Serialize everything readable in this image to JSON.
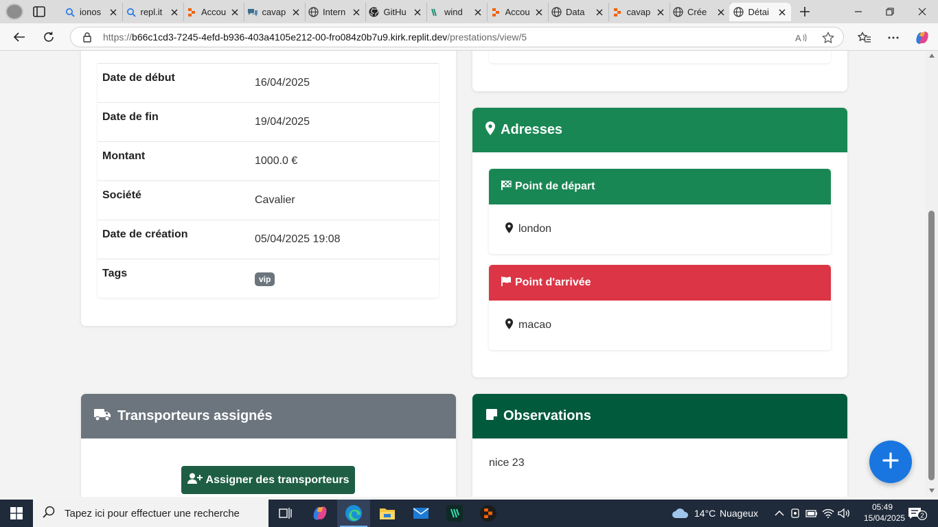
{
  "browser": {
    "tabs": [
      {
        "title": "ionos",
        "favicon": "search-icon"
      },
      {
        "title": "repl.it",
        "favicon": "search-icon"
      },
      {
        "title": "Accou",
        "favicon": "replit-icon"
      },
      {
        "title": "cavap",
        "favicon": "chat-icon"
      },
      {
        "title": "Intern",
        "favicon": "globe-icon"
      },
      {
        "title": "GitHu",
        "favicon": "github-icon"
      },
      {
        "title": "wind",
        "favicon": "windsurf-icon"
      },
      {
        "title": "Accou",
        "favicon": "replit-icon"
      },
      {
        "title": "Data",
        "favicon": "globe-icon"
      },
      {
        "title": "cavap",
        "favicon": "replit-icon"
      },
      {
        "title": "Crée",
        "favicon": "globe-icon"
      },
      {
        "title": "Détai",
        "favicon": "globe-icon",
        "active": true
      }
    ],
    "url_prefix": "https://",
    "url_host": "b66c1cd3-7245-4efd-b936-403a4105e212-00-fro084z0b7u9.kirk.replit.dev",
    "url_path": "/prestations/view/5"
  },
  "details": {
    "rows": [
      {
        "label": "Date de début",
        "value": "16/04/2025"
      },
      {
        "label": "Date de fin",
        "value": "19/04/2025"
      },
      {
        "label": "Montant",
        "value": "1000.0 €"
      },
      {
        "label": "Société",
        "value": "Cavalier"
      },
      {
        "label": "Date de création",
        "value": "05/04/2025 19:08"
      }
    ],
    "tags_label": "Tags",
    "tags": [
      "vip"
    ]
  },
  "addresses": {
    "title": "Adresses",
    "departure_title": "Point de départ",
    "departure_value": "london",
    "arrival_title": "Point d'arrivée",
    "arrival_value": "macao"
  },
  "carriers": {
    "title": "Transporteurs assignés",
    "assign_label": "Assigner des transporteurs"
  },
  "observations": {
    "title": "Observations",
    "text": "nice 23"
  },
  "colors": {
    "green": "#198754",
    "dark_green": "#015a3c",
    "red": "#dc3545",
    "gray": "#6c757d",
    "fab_blue": "#1976e0"
  },
  "taskbar": {
    "search_placeholder": "Tapez ici pour effectuer une recherche",
    "weather_temp": "14°C",
    "weather_text": "Nuageux",
    "time": "05:49",
    "date": "15/04/2025",
    "notifications": "2"
  }
}
